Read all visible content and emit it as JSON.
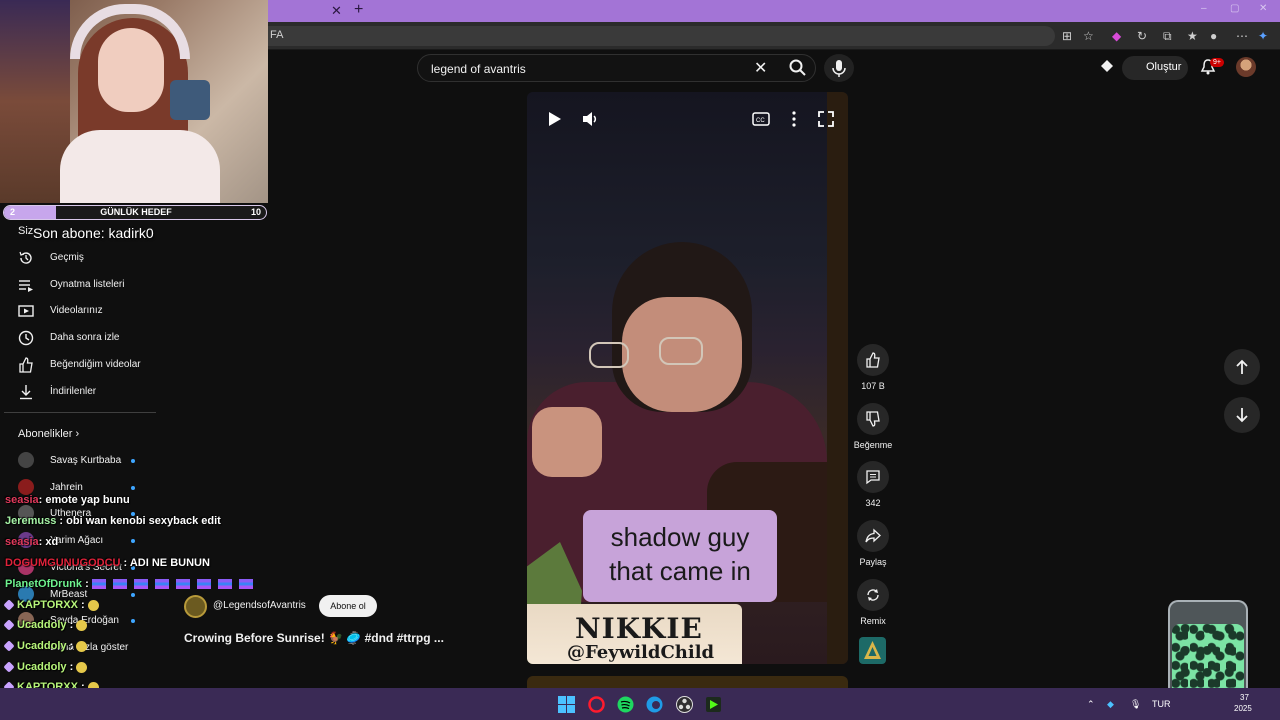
{
  "browser": {
    "tab_close": "✕",
    "tab_new": "+",
    "url_partial": "FA",
    "window_controls": [
      "–",
      "▢",
      "✕"
    ]
  },
  "youtube": {
    "search_query": "legend of avantris",
    "create_label": "Oluştur",
    "notif_count": "9+"
  },
  "overlay": {
    "goal_min": "2",
    "goal_title": "GÜNLÜK HEDEF",
    "goal_max": "10",
    "goal_progress": 0.2,
    "last_sub": "Son abone: kadirk0"
  },
  "sidebar": {
    "section_you": "Siz",
    "items": [
      {
        "label": "Geçmiş",
        "icon": "history-icon"
      },
      {
        "label": "Oynatma listeleri",
        "icon": "playlist-icon"
      },
      {
        "label": "Videolarınız",
        "icon": "your-videos-icon"
      },
      {
        "label": "Daha sonra izle",
        "icon": "watch-later-icon"
      },
      {
        "label": "Beğendiğim videolar",
        "icon": "liked-icon"
      },
      {
        "label": "İndirilenler",
        "icon": "download-icon"
      }
    ],
    "subscriptions_label": "Abonelikler",
    "channels": [
      {
        "name": "Savaş Kurtbaba",
        "color": "#444"
      },
      {
        "name": "Jahrein",
        "color": "#8a1c1c"
      },
      {
        "name": "Uthenera",
        "color": "#555"
      },
      {
        "name": "Yarim Ağacı",
        "color": "#6a3a8a"
      },
      {
        "name": "Victoria's Secret",
        "color": "#aa3366"
      },
      {
        "name": "MrBeast",
        "color": "#2a7ab0"
      },
      {
        "name": "Sevda Erdoğan",
        "color": "#886655"
      },
      {
        "name": "Daha fazla göster",
        "color": "transparent"
      }
    ]
  },
  "chat": [
    {
      "user": "seasia",
      "color": "#e0395b",
      "text": ": emote yap bunu"
    },
    {
      "user": "Jeremuss",
      "color": "#a6f3a6",
      "text": " : obi wan kenobi sexyback edit"
    },
    {
      "user": "seasia",
      "color": "#e0395b",
      "text": ": xd"
    },
    {
      "user": "DOGUMGUNUGODCU",
      "color": "#e0223a",
      "text": " : ADI NE BUNUN"
    },
    {
      "user": "PlanetOfDrunk",
      "color": "#6ff38f",
      "text": " : "
    },
    {
      "user": "KAPTORXX",
      "color": "#b7f57a",
      "text": " : "
    },
    {
      "user": "Ucaddoly",
      "color": "#b7f57a",
      "text": " : "
    },
    {
      "user": "Ucaddoly",
      "color": "#b7f57a",
      "text": " : "
    },
    {
      "user": "Ucaddoly",
      "color": "#b7f57a",
      "text": " : "
    },
    {
      "user": "KAPTORXX",
      "color": "#b7f57a",
      "text": " : "
    },
    {
      "user": "KAPTORXX",
      "color": "#b7f57a",
      "text": " : "
    }
  ],
  "video": {
    "caption_line1": "shadow guy",
    "caption_line2": "that came in",
    "nameplate_name": "NIKKIE",
    "nameplate_handle": "@FeywildChild"
  },
  "actions": {
    "likes": "107 B",
    "dislike_label": "Beğenme",
    "comments": "342",
    "share_label": "Paylaş",
    "remix_label": "Remix"
  },
  "channel": {
    "handle": "@LegendsofAvantris",
    "subscribe_label": "Abone ol",
    "video_title": "Crowing Before Sunrise! 🐓 🥏 #dnd #ttrpg ..."
  },
  "taskbar": {
    "lang": "TUR",
    "time": "37",
    "date_partial": "2025"
  },
  "colors": {
    "accent_purple": "#a374d6",
    "caption_bg": "#c7a3d9",
    "yt_bg": "#0f0f0f"
  }
}
